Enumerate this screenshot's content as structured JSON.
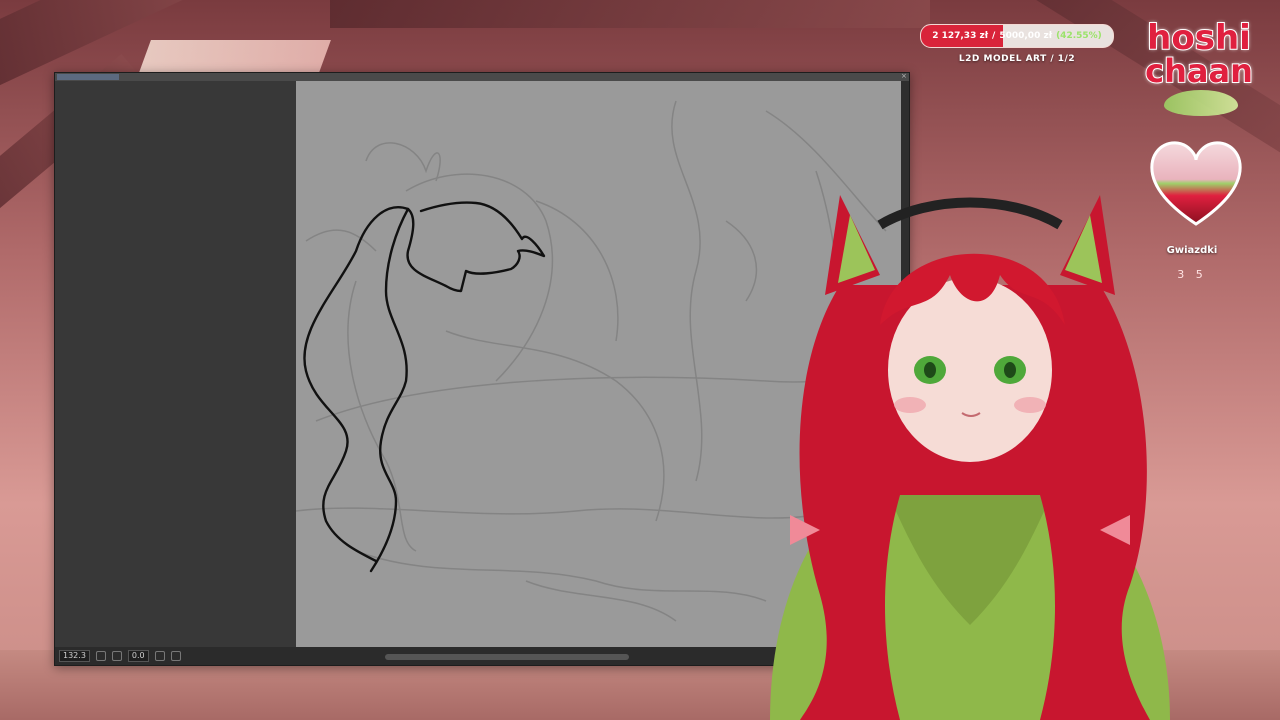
{
  "goal": {
    "current": "2 127,33 zł",
    "separator": "/",
    "target": "5000,00 zł",
    "percent_text": "(42.55%)",
    "progress": 0.4255,
    "label": "L2D MODEL ART / 1/2",
    "fill_color": "#d9243a"
  },
  "logo": {
    "line1": "hoshi",
    "line2": "chaan",
    "brand_color": "#e0203f"
  },
  "heart_widget": {
    "label": "Gwiazdki",
    "count": "3 5"
  },
  "drawing_app": {
    "statusbar": {
      "zoom": "132.3",
      "angle": "0.0"
    }
  },
  "icons": [
    "heart-icon",
    "close-icon",
    "rotate-icon",
    "flip-icon"
  ]
}
